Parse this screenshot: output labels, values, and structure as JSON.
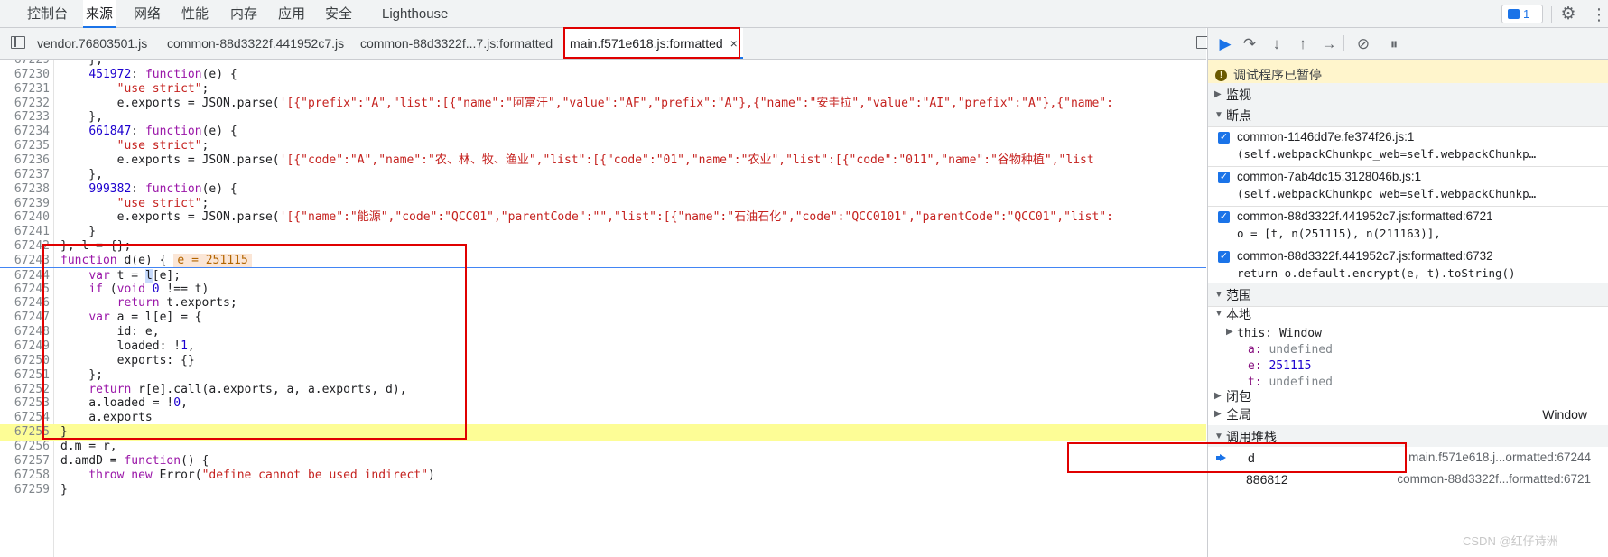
{
  "top_tabs": [
    {
      "label": "控制台"
    },
    {
      "label": "来源"
    },
    {
      "label": "网络"
    },
    {
      "label": "性能"
    },
    {
      "label": "内存"
    },
    {
      "label": "应用"
    },
    {
      "label": "安全"
    },
    {
      "label": "Lighthouse"
    }
  ],
  "issues_count": "1",
  "file_tabs": [
    {
      "label": "vendor.76803501.js"
    },
    {
      "label": "common-88d3322f.441952c7.js"
    },
    {
      "label": "common-88d3322f...7.js:formatted"
    },
    {
      "label": "main.f571e618.js:formatted"
    }
  ],
  "close_glyph": "×",
  "code_lines": [
    {
      "num": "67229",
      "html": "    },"
    },
    {
      "num": "67230",
      "html": "    <span class=\"n\">451972</span>: <span class=\"k\">function</span>(e) {"
    },
    {
      "num": "67231",
      "html": "        <span class=\"s\">\"use strict\"</span>;"
    },
    {
      "num": "67232",
      "html": "        e.exports = JSON.parse(<span class=\"s\">'[{\"prefix\":\"A\",\"list\":[{\"name\":\"阿富汗\",\"value\":\"AF\",\"prefix\":\"A\"},{\"name\":\"安圭拉\",\"value\":\"AI\",\"prefix\":\"A\"},{\"name\":</span>"
    },
    {
      "num": "67233",
      "html": "    },"
    },
    {
      "num": "67234",
      "html": "    <span class=\"n\">661847</span>: <span class=\"k\">function</span>(e) {"
    },
    {
      "num": "67235",
      "html": "        <span class=\"s\">\"use strict\"</span>;"
    },
    {
      "num": "67236",
      "html": "        e.exports = JSON.parse(<span class=\"s\">'[{\"code\":\"A\",\"name\":\"农、林、牧、渔业\",\"list\":[{\"code\":\"01\",\"name\":\"农业\",\"list\":[{\"code\":\"011\",\"name\":\"谷物种植\",\"list</span>"
    },
    {
      "num": "67237",
      "html": "    },"
    },
    {
      "num": "67238",
      "html": "    <span class=\"n\">999382</span>: <span class=\"k\">function</span>(e) {"
    },
    {
      "num": "67239",
      "html": "        <span class=\"s\">\"use strict\"</span>;"
    },
    {
      "num": "67240",
      "html": "        e.exports = JSON.parse(<span class=\"s\">'[{\"name\":\"能源\",\"code\":\"QCC01\",\"parentCode\":\"\",\"list\":[{\"name\":\"石油石化\",\"code\":\"QCC0101\",\"parentCode\":\"QCC01\",\"list\":</span>"
    },
    {
      "num": "67241",
      "html": "    }"
    },
    {
      "num": "67242",
      "html": "}, l = {};"
    },
    {
      "num": "67243",
      "html": "<span class=\"k\">function</span> d(e) {<span class=\"inline-val\">e = 251115</span>"
    },
    {
      "num": "67244",
      "html": "    <span class=\"k\">var</span> t = <span class=\"caret-hl\">l</span>[e];"
    },
    {
      "num": "67245",
      "html": "    <span class=\"k\">if</span> (<span class=\"k\">void</span> <span class=\"n\">0</span> !== t)"
    },
    {
      "num": "67246",
      "html": "        <span class=\"k\">return</span> t.exports;"
    },
    {
      "num": "67247",
      "html": "    <span class=\"k\">var</span> a = l[e] = {"
    },
    {
      "num": "67248",
      "html": "        id: e,"
    },
    {
      "num": "67249",
      "html": "        loaded: !<span class=\"n\">1</span>,"
    },
    {
      "num": "67250",
      "html": "        exports: {}"
    },
    {
      "num": "67251",
      "html": "    };"
    },
    {
      "num": "67252",
      "html": "    <span class=\"k\">return</span> r[e].call(a.exports, a, a.exports, d),"
    },
    {
      "num": "67253",
      "html": "    a.loaded = !<span class=\"n\">0</span>,"
    },
    {
      "num": "67254",
      "html": "    a.exports"
    },
    {
      "num": "67255",
      "html": "}"
    },
    {
      "num": "67256",
      "html": "d.m = r,"
    },
    {
      "num": "67257",
      "html": "d.amdD = <span class=\"k\">function</span>() {"
    },
    {
      "num": "67258",
      "html": "    <span class=\"k\">throw</span> <span class=\"k\">new</span> Error(<span class=\"s\">\"define cannot be used indirect\"</span>)"
    },
    {
      "num": "67259",
      "html": "}"
    }
  ],
  "debugger": {
    "paused_message": "调试程序已暂停",
    "sections": {
      "watch": "监视",
      "breakpoints": "断点",
      "scope": "范围",
      "call_stack": "调用堆栈"
    },
    "breakpoints": [
      {
        "location": "common-1146dd7e.fe374f26.js:1",
        "snippet": "(self.webpackChunkpc_web=self.webpackChunkp…"
      },
      {
        "location": "common-7ab4dc15.3128046b.js:1",
        "snippet": "(self.webpackChunkpc_web=self.webpackChunkp…"
      },
      {
        "location": "common-88d3322f.441952c7.js:formatted:6721",
        "snippet": "o = [t, n(251115), n(211163)],"
      },
      {
        "location": "common-88d3322f.441952c7.js:formatted:6732",
        "snippet": "return o.default.encrypt(e, t).toString()"
      }
    ],
    "scope": {
      "local_label": "本地",
      "this_label": "this: Window",
      "vars": [
        {
          "name": "a",
          "value": "undefined",
          "kind": "undef"
        },
        {
          "name": "e",
          "value": "251115",
          "kind": "num"
        },
        {
          "name": "t",
          "value": "undefined",
          "kind": "undef"
        }
      ],
      "closure_label": "闭包",
      "global_label": "全局",
      "global_value": "Window"
    },
    "call_stack": [
      {
        "name": "d",
        "location": "main.f571e618.j...ormatted:67244"
      },
      {
        "name": "886812",
        "location": "common-88d3322f...formatted:6721"
      }
    ]
  },
  "watermark": "CSDN @红仔诗洲",
  "colors": {
    "accent": "#1a73e8",
    "paused_line": "#fdfd96",
    "annotation_box": "#e00000"
  }
}
